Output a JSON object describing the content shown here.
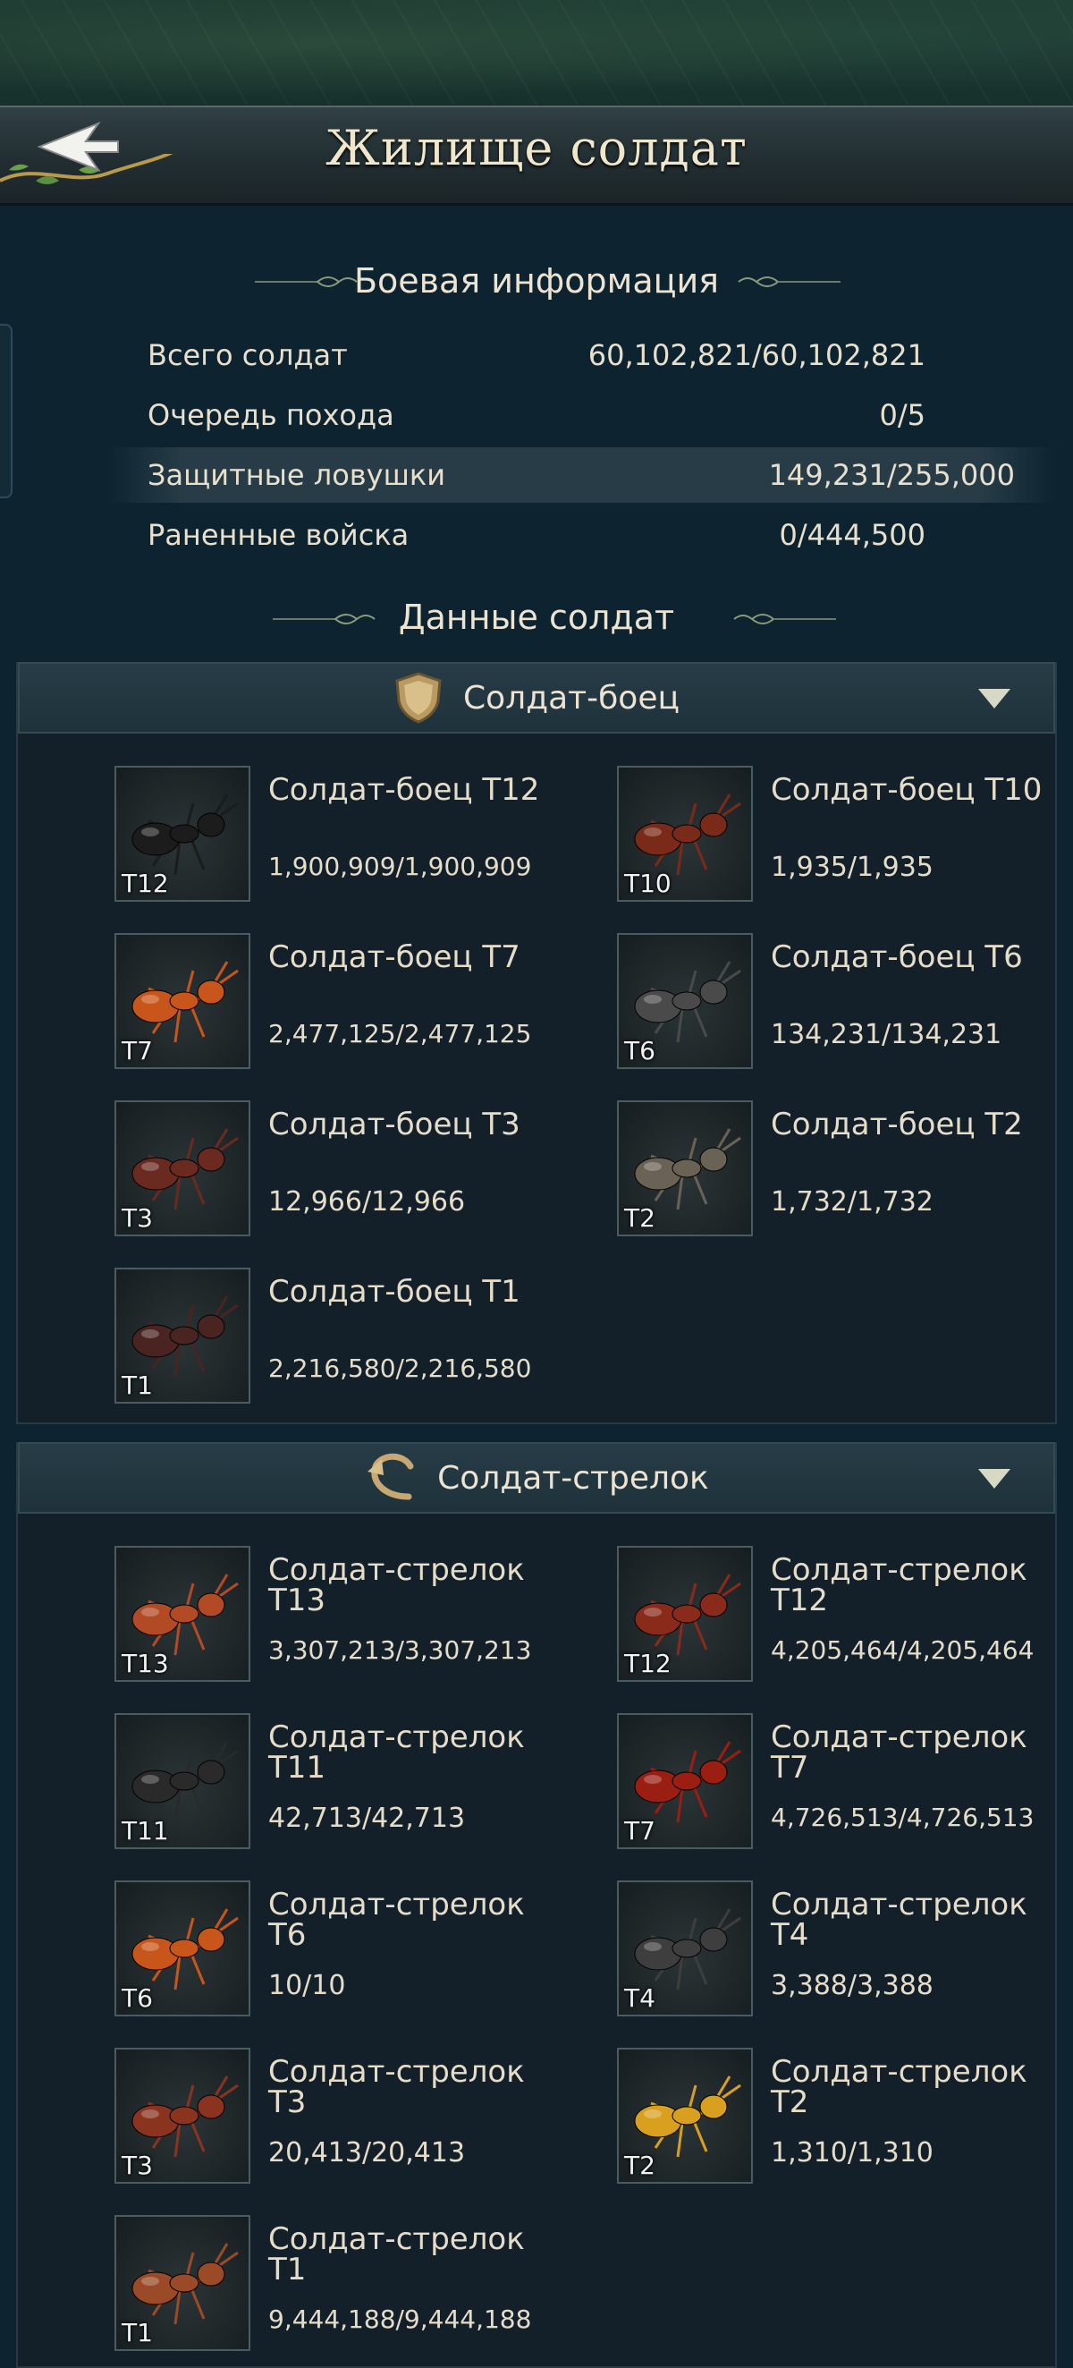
{
  "header": {
    "title": "Жилище солдат"
  },
  "battle_info": {
    "section_title": "Боевая информация",
    "rows": [
      {
        "label": "Всего солдат",
        "value": "60,102,821/60,102,821"
      },
      {
        "label": "Очередь похода",
        "value": "0/5"
      },
      {
        "label": "Защитные ловушки",
        "value": "149,231/255,000"
      },
      {
        "label": "Раненные войска",
        "value": "0/444,500"
      }
    ]
  },
  "soldier_data": {
    "section_title": "Данные солдат"
  },
  "fighters": {
    "category": "Солдат-боец",
    "units": [
      {
        "name": "Солдат-боец T12",
        "tier": "T12",
        "count": "1,900,909/1,900,909",
        "color": "#1c1c1c"
      },
      {
        "name": "Солдат-боец T10",
        "tier": "T10",
        "count": "1,935/1,935",
        "color": "#7a2a18"
      },
      {
        "name": "Солдат-боец T7",
        "tier": "T7",
        "count": "2,477,125/2,477,125",
        "color": "#c8561a"
      },
      {
        "name": "Солдат-боец T6",
        "tier": "T6",
        "count": "134,231/134,231",
        "color": "#4a4a4a"
      },
      {
        "name": "Солдат-боец T3",
        "tier": "T3",
        "count": "12,966/12,966",
        "color": "#6a2a20"
      },
      {
        "name": "Солдат-боец T2",
        "tier": "T2",
        "count": "1,732/1,732",
        "color": "#6a6255"
      },
      {
        "name": "Солдат-боец T1",
        "tier": "T1",
        "count": "2,216,580/2,216,580",
        "color": "#4a2420"
      }
    ]
  },
  "shooters": {
    "category": "Солдат-стрелок",
    "units": [
      {
        "name_line1": "Солдат-стрелок",
        "name_line2": "T13",
        "tier": "T13",
        "count": "3,307,213/3,307,213",
        "color": "#b24a26"
      },
      {
        "name_line1": "Солдат-стрелок",
        "name_line2": "T12",
        "tier": "T12",
        "count": "4,205,464/4,205,464",
        "color": "#8a2a1a"
      },
      {
        "name_line1": "Солдат-стрелок",
        "name_line2": "T11",
        "tier": "T11",
        "count": "42,713/42,713",
        "color": "#2a2a2a"
      },
      {
        "name_line1": "Солдат-стрелок",
        "name_line2": "T7",
        "tier": "T7",
        "count": "4,726,513/4,726,513",
        "color": "#9a1e12"
      },
      {
        "name_line1": "Солдат-стрелок",
        "name_line2": "T6",
        "tier": "T6",
        "count": "10/10",
        "color": "#c8561a"
      },
      {
        "name_line1": "Солдат-стрелок",
        "name_line2": "T4",
        "tier": "T4",
        "count": "3,388/3,388",
        "color": "#3e3e3e"
      },
      {
        "name_line1": "Солдат-стрелок",
        "name_line2": "T3",
        "tier": "T3",
        "count": "20,413/20,413",
        "color": "#8a3420"
      },
      {
        "name_line1": "Солдат-стрелок",
        "name_line2": "T2",
        "tier": "T2",
        "count": "1,310/1,310",
        "color": "#d9a020"
      },
      {
        "name_line1": "Солдат-стрелок",
        "name_line2": "T1",
        "tier": "T1",
        "count": "9,444,188/9,444,188",
        "color": "#9a4a26"
      }
    ]
  }
}
